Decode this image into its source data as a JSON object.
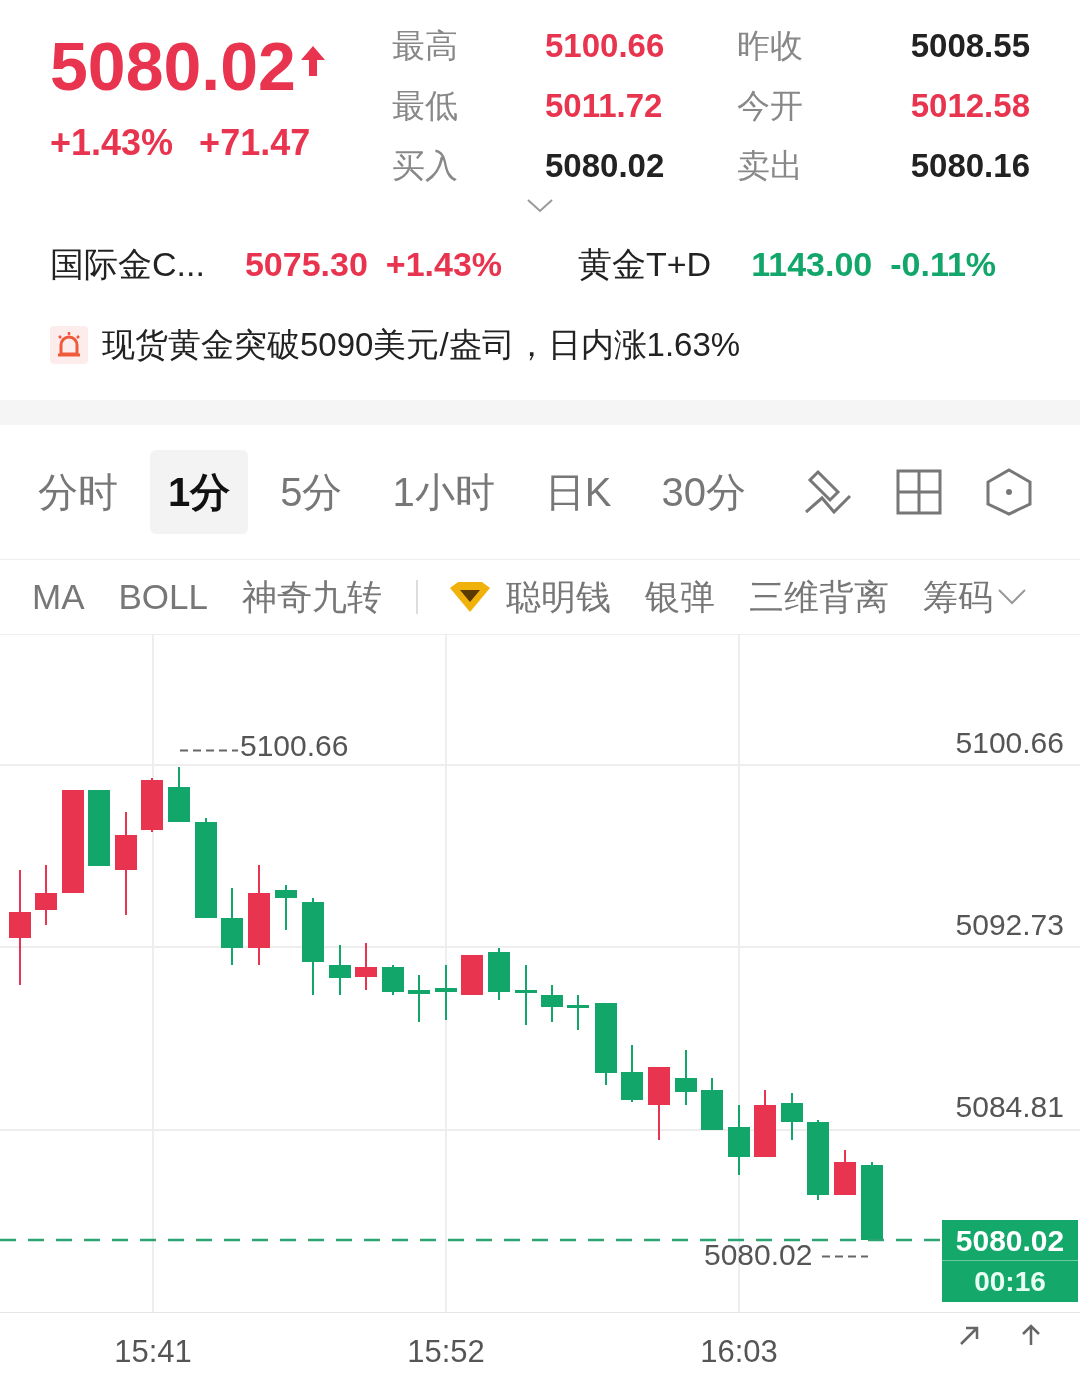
{
  "quote": {
    "price": "5080.02",
    "rising": true,
    "change_pct": "+1.43%",
    "change_abs": "+71.47"
  },
  "stats": [
    {
      "label": "最高",
      "value": "5100.66",
      "color": "#e8344e"
    },
    {
      "label": "昨收",
      "value": "5008.55",
      "color": "#222222"
    },
    {
      "label": "最低",
      "value": "5011.72",
      "color": "#e8344e"
    },
    {
      "label": "今开",
      "value": "5012.58",
      "color": "#e8344e"
    },
    {
      "label": "买入",
      "value": "5080.02",
      "color": "#222222"
    },
    {
      "label": "卖出",
      "value": "5080.16",
      "color": "#222222"
    }
  ],
  "related": [
    {
      "name": "国际金C...",
      "price": "5075.30",
      "change": "+1.43%",
      "color": "#e8344e"
    },
    {
      "name": "黄金T+D",
      "price": "1143.00",
      "change": "-0.11%",
      "color": "#12a66b"
    }
  ],
  "news": {
    "text": "现货黄金突破5090美元/盎司，日内涨1.63%"
  },
  "period_tabs": [
    {
      "label": "分时",
      "selected": false
    },
    {
      "label": "1分",
      "selected": true
    },
    {
      "label": "5分",
      "selected": false
    },
    {
      "label": "1小时",
      "selected": false
    },
    {
      "label": "日K",
      "selected": false
    },
    {
      "label": "30分",
      "selected": false
    }
  ],
  "indicators": [
    {
      "label": "MA",
      "kind": "plain"
    },
    {
      "label": "BOLL",
      "kind": "plain"
    },
    {
      "label": "神奇九转",
      "kind": "plain"
    },
    {
      "label": "聪明钱",
      "kind": "premium"
    },
    {
      "label": "银弹",
      "kind": "plain"
    },
    {
      "label": "三维背离",
      "kind": "plain"
    },
    {
      "label": "筹码",
      "kind": "plain"
    }
  ],
  "chart": {
    "high_marker": "5100.66",
    "low_marker": "5080.02",
    "y_labels": [
      "5100.66",
      "5092.73",
      "5084.81"
    ],
    "current": {
      "price": "5080.02",
      "countdown": "00:16"
    },
    "x_labels": [
      "15:41",
      "15:52",
      "16:03"
    ]
  }
}
